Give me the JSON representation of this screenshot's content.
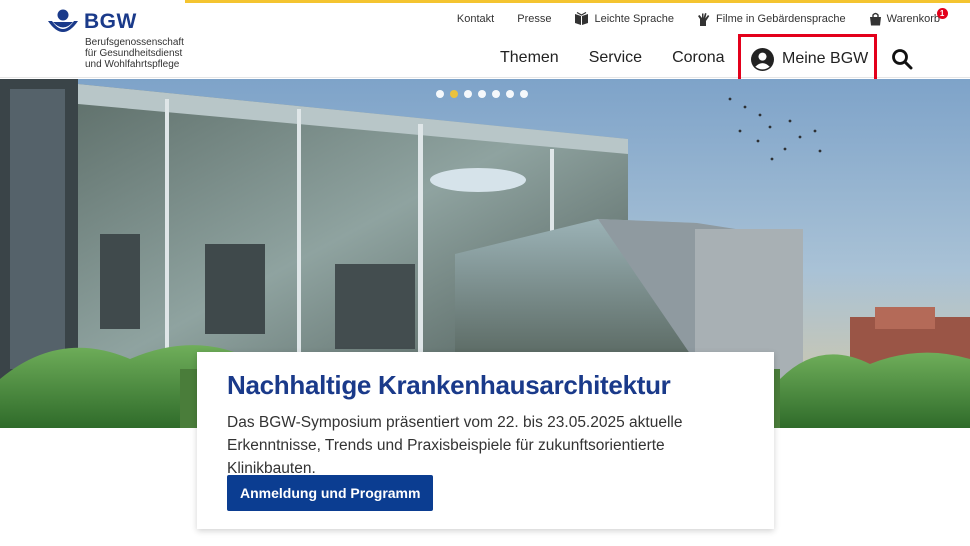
{
  "brand": {
    "name": "BGW",
    "subtitle_lines": [
      "Berufsgenossenschaft",
      "für Gesundheitsdienst",
      "und Wohlfahrtspflege"
    ],
    "color": "#1a3a8a"
  },
  "utility_nav": {
    "kontakt": "Kontakt",
    "presse": "Presse",
    "leichte_sprache": "Leichte Sprache",
    "filme": "Filme in Gebärdensprache",
    "warenkorb": "Warenkorb",
    "cart_count": "1"
  },
  "main_nav": {
    "themen": "Themen",
    "service": "Service",
    "corona": "Corona",
    "meine_bgw": "Meine BGW"
  },
  "icons": {
    "leichte_sprache": "book-icon",
    "filme": "sign-language-hand-icon",
    "warenkorb": "shopping-bag-icon",
    "meine_bgw": "user-circle-icon",
    "search": "search-icon"
  },
  "carousel": {
    "slide_count": 7,
    "active_index": 1
  },
  "teaser": {
    "title": "Nachhaltige Krankenhausarchitektur",
    "text": "Das BGW-Symposium präsentiert vom 22. bis 23.05.2025 aktuelle Erkenntnisse, Trends und Praxisbeispiele für zukunftsorientierte Klinikbauten.",
    "button": "Anmeldung und Programm"
  },
  "colors": {
    "accent_yellow": "#f4c430",
    "highlight_red": "#e3001b",
    "button_blue": "#0b3d91"
  }
}
